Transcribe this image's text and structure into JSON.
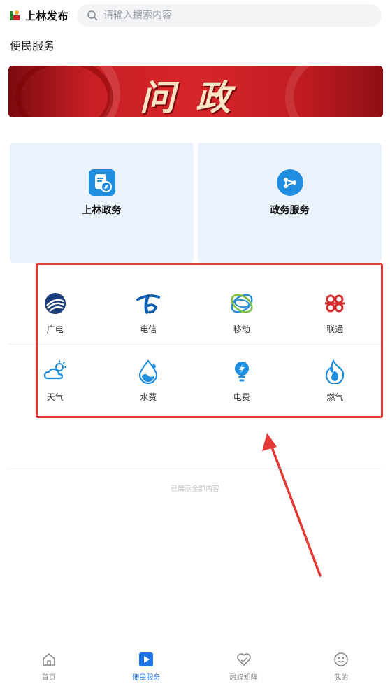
{
  "header": {
    "app_title": "上林发布",
    "search_placeholder": "请输入搜索内容"
  },
  "section_title": "便民服务",
  "banner": {
    "text": "问政"
  },
  "cards": [
    {
      "label": "上林政务",
      "icon": "document-compass-icon"
    },
    {
      "label": "政务服务",
      "icon": "share-nodes-icon"
    }
  ],
  "services": {
    "row1": [
      {
        "label": "广电",
        "icon": "broadcast-logo-icon"
      },
      {
        "label": "电信",
        "icon": "telecom-logo-icon"
      },
      {
        "label": "移动",
        "icon": "mobile-logo-icon"
      },
      {
        "label": "联通",
        "icon": "unicom-logo-icon"
      }
    ],
    "row2": [
      {
        "label": "天气",
        "icon": "weather-icon"
      },
      {
        "label": "水费",
        "icon": "water-drop-icon"
      },
      {
        "label": "电费",
        "icon": "electricity-bulb-icon"
      },
      {
        "label": "燃气",
        "icon": "gas-flame-icon"
      }
    ]
  },
  "end_note": "已展示全部内容",
  "tabbar": [
    {
      "label": "首页",
      "icon": "home-icon",
      "active": false
    },
    {
      "label": "便民服务",
      "icon": "play-square-icon",
      "active": true
    },
    {
      "label": "融媒矩阵",
      "icon": "heart-hand-icon",
      "active": false
    },
    {
      "label": "我的",
      "icon": "smile-face-icon",
      "active": false
    }
  ],
  "colors": {
    "accent": "#1f73e8",
    "service_blue": "#1f8de0",
    "highlight_red": "#e53935"
  }
}
